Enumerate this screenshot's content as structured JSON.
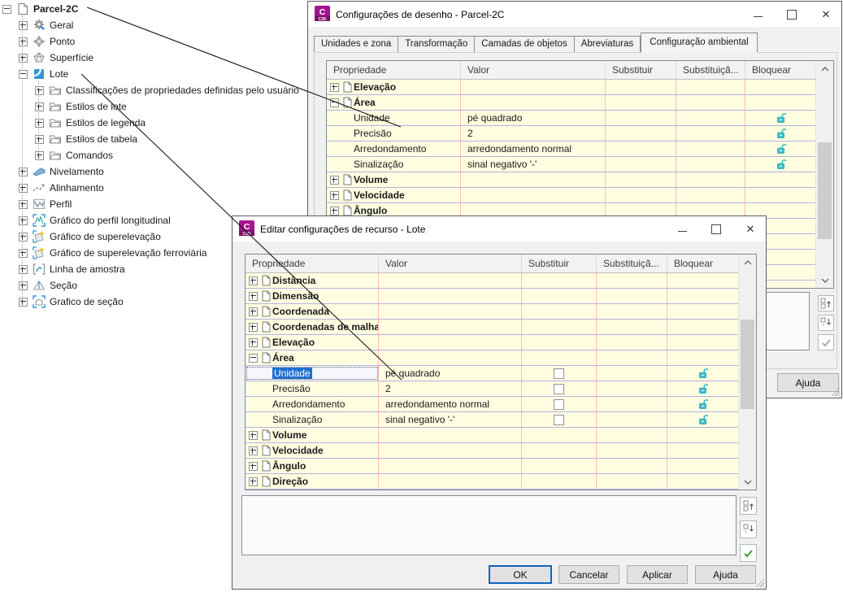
{
  "tree": {
    "items": [
      {
        "label": "Parcel-2C",
        "icon": "drawing-file-icon",
        "level": 0,
        "expand": "minus",
        "bold": true
      },
      {
        "label": "Geral",
        "icon": "gear-icon",
        "level": 1,
        "expand": "plus"
      },
      {
        "label": "Ponto",
        "icon": "point-icon",
        "level": 1,
        "expand": "plus"
      },
      {
        "label": "Superfície",
        "icon": "surface-icon",
        "level": 1,
        "expand": "plus"
      },
      {
        "label": "Lote",
        "icon": "parcel-icon",
        "level": 1,
        "expand": "minus"
      },
      {
        "label": "Classificações de propriedades definidas pelo usuário",
        "icon": "folder-icon",
        "level": 2,
        "expand": "plus"
      },
      {
        "label": "Estilos de lote",
        "icon": "folder-icon",
        "level": 2,
        "expand": "plus"
      },
      {
        "label": "Estilos de legenda",
        "icon": "folder-icon",
        "level": 2,
        "expand": "plus"
      },
      {
        "label": "Estilos de tabela",
        "icon": "folder-icon",
        "level": 2,
        "expand": "plus"
      },
      {
        "label": "Comandos",
        "icon": "folder-icon",
        "level": 2,
        "expand": "plus"
      },
      {
        "label": "Nivelamento",
        "icon": "grading-icon",
        "level": 1,
        "expand": "plus"
      },
      {
        "label": "Alinhamento",
        "icon": "alignment-icon",
        "level": 1,
        "expand": "plus"
      },
      {
        "label": "Perfil",
        "icon": "profile-icon",
        "level": 1,
        "expand": "plus"
      },
      {
        "label": "Gráfico do perfil longitudinal",
        "icon": "profile-view-icon",
        "level": 1,
        "expand": "plus"
      },
      {
        "label": "Gráfico de superelevação",
        "icon": "superelevation-view-icon",
        "level": 1,
        "expand": "plus"
      },
      {
        "label": "Gráfico de superelevação ferroviária",
        "icon": "superelevation-rail-view-icon",
        "level": 1,
        "expand": "plus"
      },
      {
        "label": "Linha de amostra",
        "icon": "sample-line-icon",
        "level": 1,
        "expand": "plus"
      },
      {
        "label": "Seção",
        "icon": "section-icon",
        "level": 1,
        "expand": "plus"
      },
      {
        "label": "Grafico de seção",
        "icon": "section-view-icon",
        "level": 1,
        "expand": "plus"
      }
    ]
  },
  "dialog_drawing": {
    "title": "Configurações de desenho - Parcel-2C",
    "app_icon": "C3D",
    "tabs": [
      "Unidades e zona",
      "Transformação",
      "Camadas de objetos",
      "Abreviaturas",
      "Configuração ambiental"
    ],
    "active_tab": "Configuração ambiental",
    "table": {
      "columns": [
        "Propriedade",
        "Valor",
        "Substituir",
        "Substituiçã...",
        "Bloquear"
      ],
      "rows": [
        {
          "type": "category",
          "label": "Elevação",
          "expanded": false
        },
        {
          "type": "category",
          "label": "Área",
          "expanded": true
        },
        {
          "type": "property",
          "label": "Unidade",
          "value": "pé quadrado",
          "locked": true
        },
        {
          "type": "property",
          "label": "Precisão",
          "value": "2",
          "locked": true
        },
        {
          "type": "property",
          "label": "Arredondamento",
          "value": "arredondamento normal",
          "locked": true
        },
        {
          "type": "property",
          "label": "Sinalização",
          "value": "sinal negativo '-'",
          "locked": true
        },
        {
          "type": "category",
          "label": "Volume",
          "expanded": false
        },
        {
          "type": "category",
          "label": "Velocidade",
          "expanded": false
        },
        {
          "type": "category",
          "label": "Ângulo",
          "expanded": false
        }
      ]
    },
    "help_label": "Ajuda"
  },
  "dialog_feature": {
    "title": "Editar configurações de recurso - Lote",
    "app_icon": "C3D",
    "table": {
      "columns": [
        "Propriedade",
        "Valor",
        "Substituir",
        "Substituiçã...",
        "Bloquear"
      ],
      "rows": [
        {
          "type": "category",
          "label": "Distância",
          "expanded": false
        },
        {
          "type": "category",
          "label": "Dimensão",
          "expanded": false
        },
        {
          "type": "category",
          "label": "Coordenada",
          "expanded": false
        },
        {
          "type": "category",
          "label": "Coordenadas de malha",
          "expanded": false
        },
        {
          "type": "category",
          "label": "Elevação",
          "expanded": false
        },
        {
          "type": "category",
          "label": "Área",
          "expanded": true
        },
        {
          "type": "property",
          "label": "Unidade",
          "value": "pé quadrado",
          "override_checkbox": true,
          "checked": false,
          "locked": true,
          "selected": true
        },
        {
          "type": "property",
          "label": "Precisão",
          "value": "2",
          "override_checkbox": true,
          "checked": false,
          "locked": true
        },
        {
          "type": "property",
          "label": "Arredondamento",
          "value": "arredondamento normal",
          "override_checkbox": true,
          "checked": false,
          "locked": true
        },
        {
          "type": "property",
          "label": "Sinalização",
          "value": "sinal negativo '-'",
          "override_checkbox": true,
          "checked": false,
          "locked": true
        },
        {
          "type": "category",
          "label": "Volume",
          "expanded": false
        },
        {
          "type": "category",
          "label": "Velocidade",
          "expanded": false
        },
        {
          "type": "category",
          "label": "Ângulo",
          "expanded": false
        },
        {
          "type": "category",
          "label": "Direção",
          "expanded": false
        }
      ]
    },
    "buttons": [
      "OK",
      "Cancelar",
      "Aplicar",
      "Ajuda"
    ],
    "default_button": "OK"
  },
  "colors": {
    "selection_blue": "#1f6fd0",
    "row_background": "#fffee1",
    "grid_horizontal": "#b3b3df",
    "grid_vertical": "#f1bdbd",
    "lock_teal": "#3dbfc7",
    "app_icon_magenta": "#a4148c"
  }
}
